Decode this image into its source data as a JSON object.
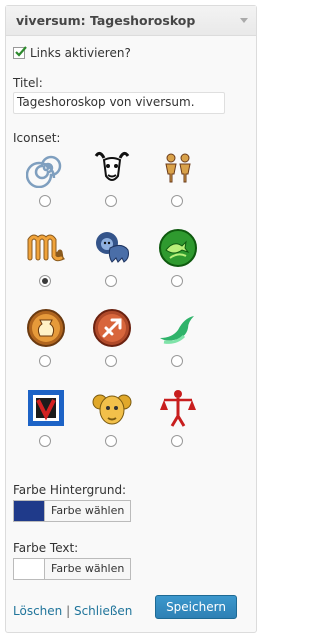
{
  "widget": {
    "title": "viversum: Tageshoroskop",
    "links_checkbox_label": "Links aktivieren?",
    "title_label": "Titel:",
    "title_value": "Tageshoroskop von viversum.",
    "iconset_label": "Iconset:",
    "iconsets": [
      {
        "icon": "spiral-icon",
        "selected": false
      },
      {
        "icon": "bull-head-icon",
        "selected": false
      },
      {
        "icon": "twins-icon",
        "selected": false
      },
      {
        "icon": "scorpio-glyph-icon",
        "selected": true
      },
      {
        "icon": "lion-icon",
        "selected": false
      },
      {
        "icon": "pisces-fish-icon",
        "selected": false
      },
      {
        "icon": "aquarius-vase-icon",
        "selected": false
      },
      {
        "icon": "sagittarius-arrow-icon",
        "selected": false
      },
      {
        "icon": "green-swirl-icon",
        "selected": false
      },
      {
        "icon": "framed-v-icon",
        "selected": false
      },
      {
        "icon": "ram-head-icon",
        "selected": false
      },
      {
        "icon": "libra-figure-icon",
        "selected": false
      }
    ],
    "bg_color_label": "Farbe Hintergrund:",
    "bg_color_value": "#1f3a8a",
    "text_color_label": "Farbe Text:",
    "text_color_value": "#ffffff",
    "choose_color_label": "Farbe wählen",
    "delete_link": "Löschen",
    "separator": "|",
    "close_link": "Schließen",
    "save_label": "Speichern"
  }
}
